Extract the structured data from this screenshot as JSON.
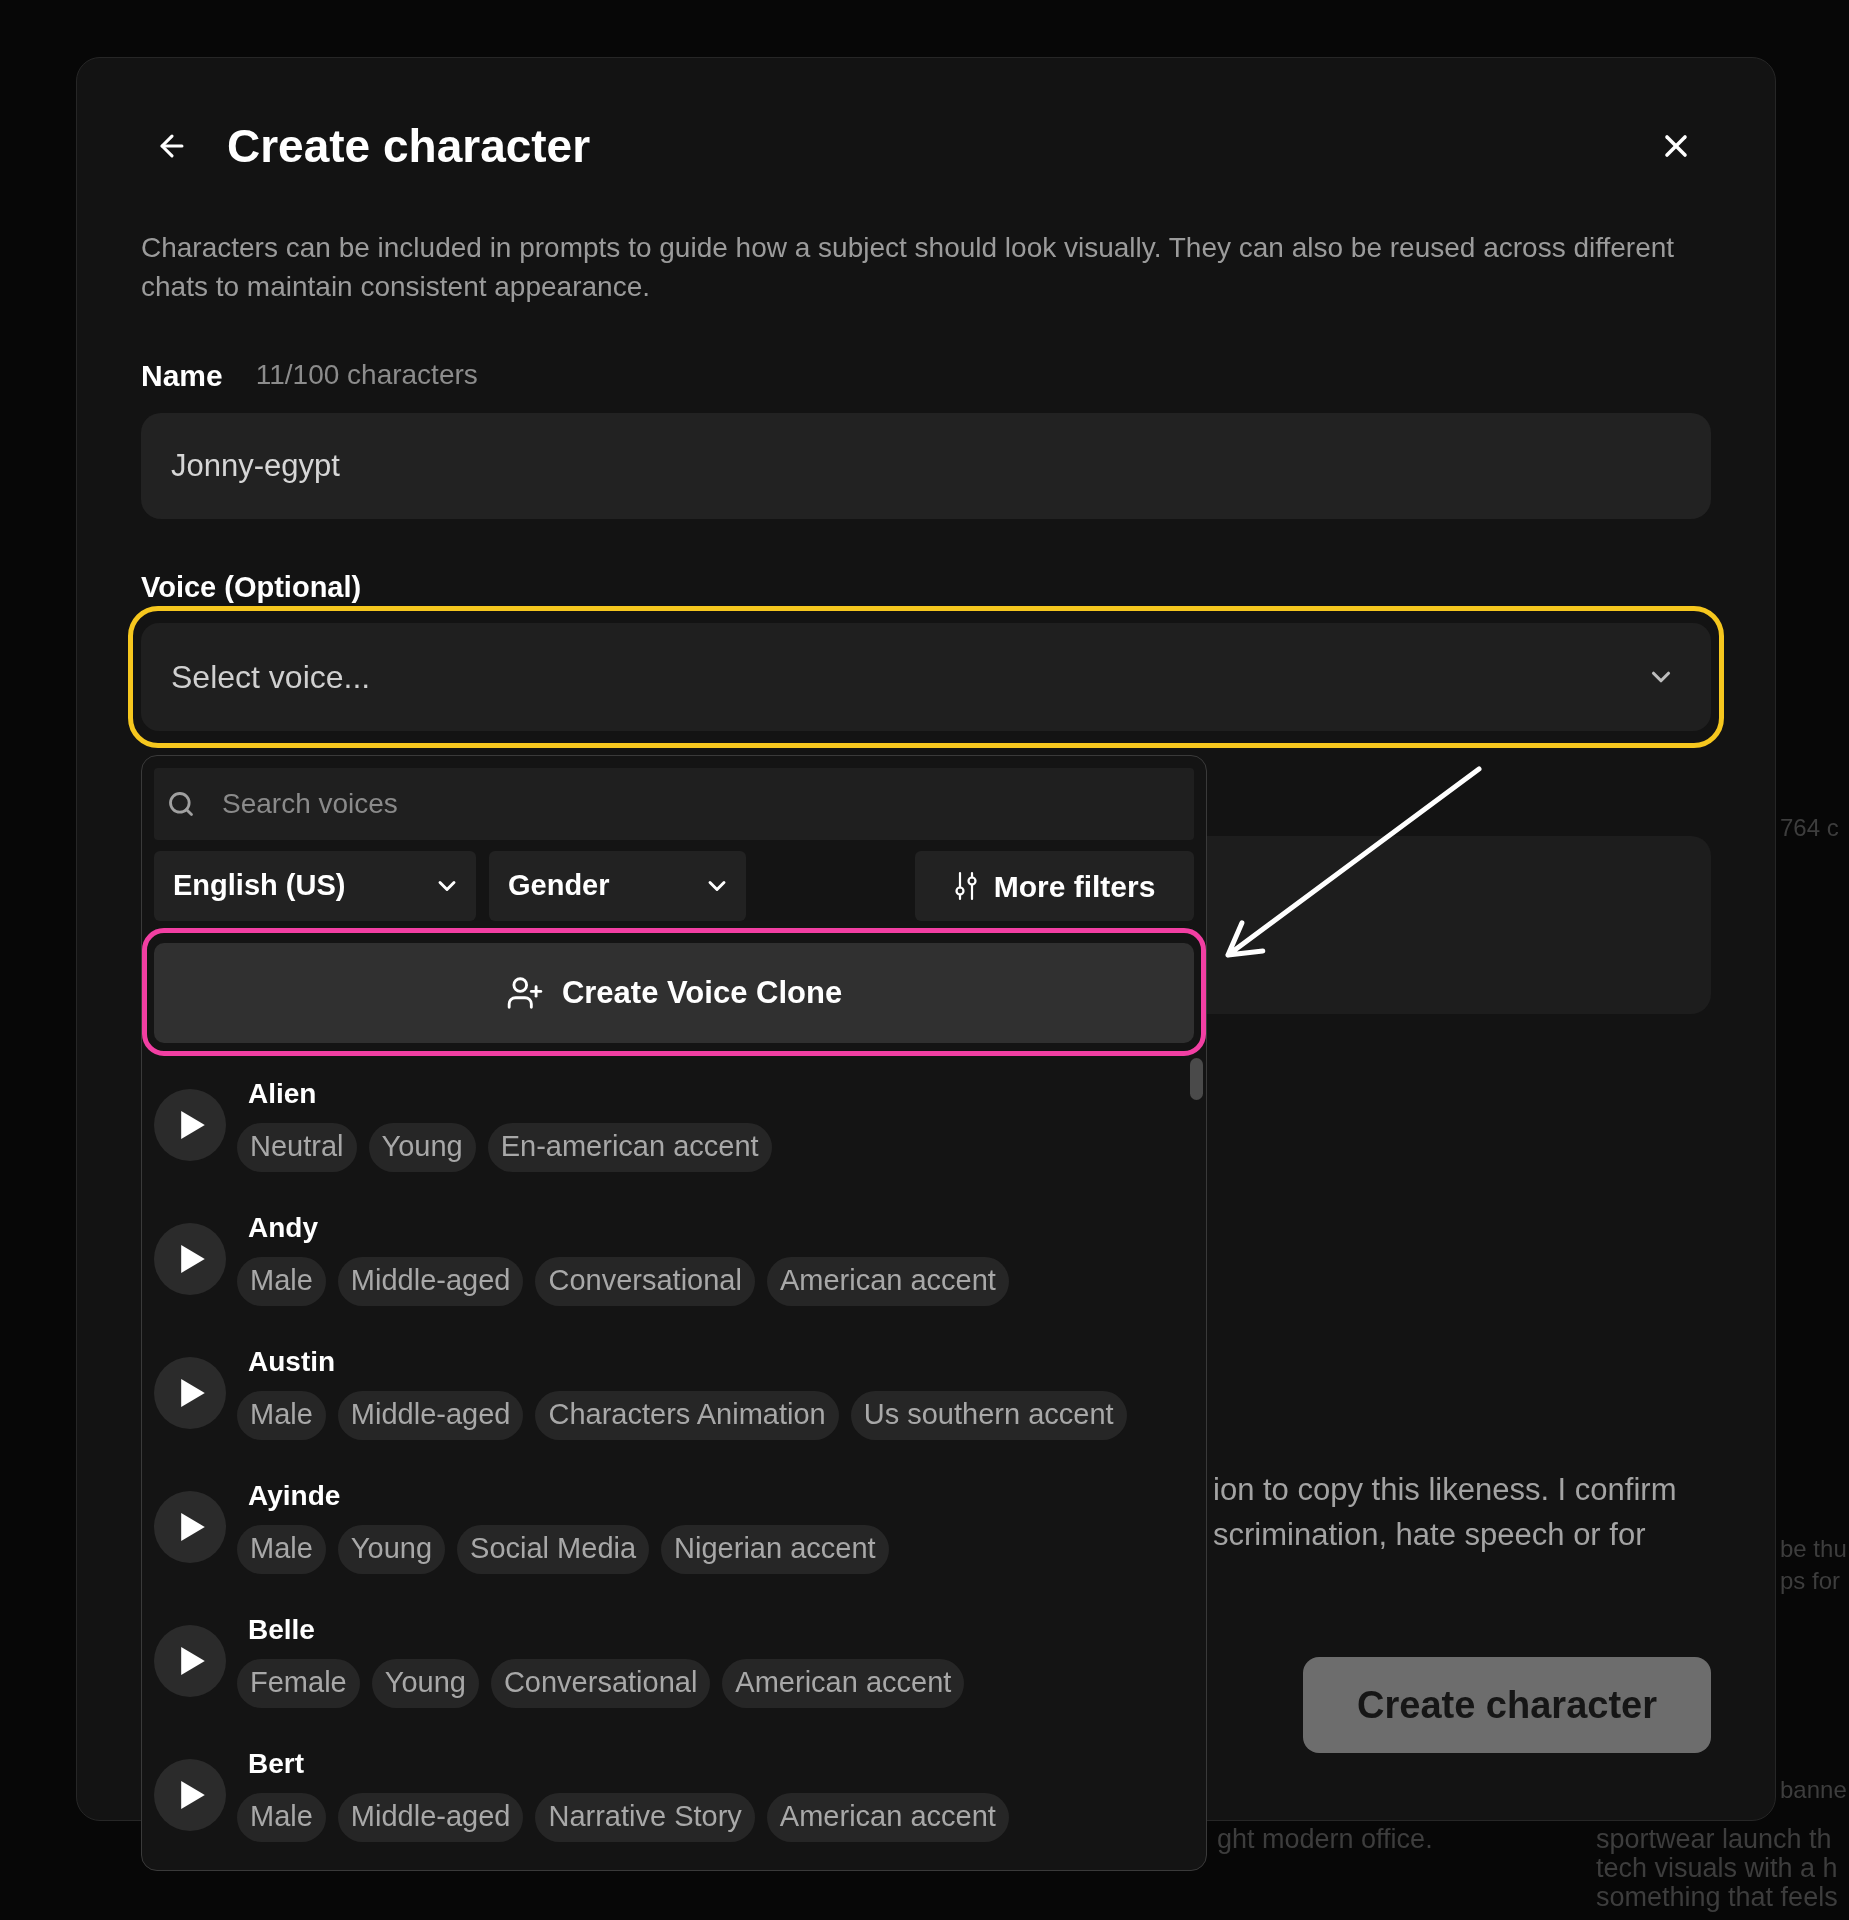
{
  "dialog": {
    "title": "Create character",
    "description": "Characters can be included in prompts to guide how a subject should look visually. They can also be reused across different chats to maintain consistent appearance."
  },
  "name_field": {
    "label": "Name",
    "counter": "11/100 characters",
    "value": "Jonny-egypt"
  },
  "voice_field": {
    "label": "Voice (Optional)",
    "placeholder": "Select voice...",
    "expanded": true
  },
  "voice_dropdown": {
    "search": {
      "placeholder": "Search voices"
    },
    "filters": [
      {
        "kind": "select",
        "label": "English (US)"
      },
      {
        "kind": "select",
        "label": "Gender"
      },
      {
        "kind": "button",
        "label": "More filters"
      }
    ],
    "clone_button": "Create Voice Clone",
    "voices": [
      {
        "name": "Alien",
        "tags": [
          "Neutral",
          "Young",
          "En-american accent"
        ]
      },
      {
        "name": "Andy",
        "tags": [
          "Male",
          "Middle-aged",
          "Conversational",
          "American accent"
        ]
      },
      {
        "name": "Austin",
        "tags": [
          "Male",
          "Middle-aged",
          "Characters Animation",
          "Us southern accent"
        ]
      },
      {
        "name": "Ayinde",
        "tags": [
          "Male",
          "Young",
          "Social Media",
          "Nigerian accent"
        ]
      },
      {
        "name": "Belle",
        "tags": [
          "Female",
          "Young",
          "Conversational",
          "American accent"
        ]
      },
      {
        "name": "Bert",
        "tags": [
          "Male",
          "Middle-aged",
          "Narrative Story",
          "American accent"
        ]
      }
    ]
  },
  "consent_text": [
    "ion to copy this likeness. I confirm",
    "scrimination, hate speech or for"
  ],
  "submit_button": {
    "label": "Create character",
    "disabled": true
  },
  "background": {
    "side_texts": [
      "764 c",
      "be thu",
      "ps for",
      "banne"
    ],
    "card_text": "ght modern office.",
    "card_lines": [
      "sportwear launch th",
      "tech visuals with a h",
      "something that feels"
    ]
  }
}
